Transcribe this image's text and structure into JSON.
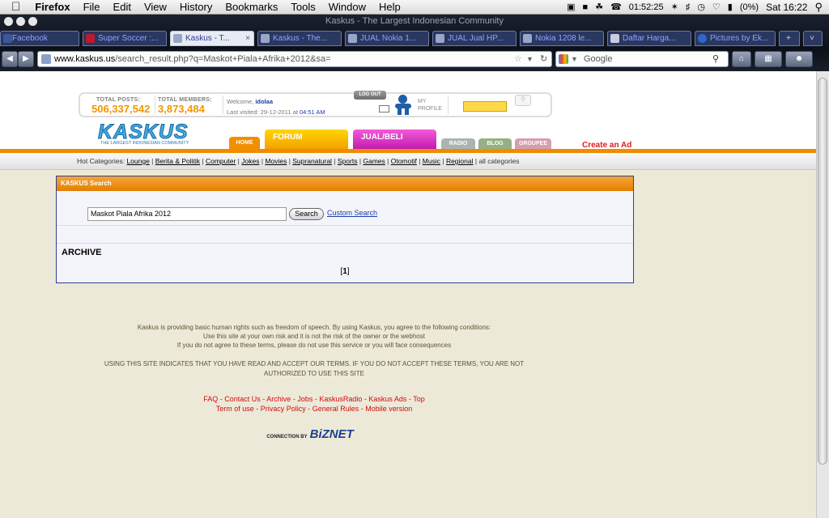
{
  "menubar": {
    "app": "Firefox",
    "items": [
      "File",
      "Edit",
      "View",
      "History",
      "Bookmarks",
      "Tools",
      "Window",
      "Help"
    ],
    "timer": "01:52:25",
    "battery": "(0%)",
    "clock": "Sat 16:22"
  },
  "window": {
    "title": "Kaskus - The Largest Indonesian Community"
  },
  "tabs": [
    {
      "label": "Facebook"
    },
    {
      "label": "Super Soccer :..."
    },
    {
      "label": "Kaskus - T..."
    },
    {
      "label": "Kaskus - The..."
    },
    {
      "label": "JUAL Nokia 1..."
    },
    {
      "label": "JUAL Jual HP..."
    },
    {
      "label": "Nokia 1208 le..."
    },
    {
      "label": "Daftar Harga..."
    },
    {
      "label": "Pictures by Ek..."
    }
  ],
  "navbar": {
    "url_domain": "www.kaskus.us",
    "url_path": "/search_result.php?q=Maskot+Piala+Afrika+2012&sa=",
    "search_engine": "Google"
  },
  "header": {
    "total_posts_label": "TOTAL POSTS:",
    "total_posts": "506,337,542",
    "total_members_label": "TOTAL MEMBERS:",
    "total_members": "3,873,484",
    "welcome_prefix": "Welcome,",
    "username": "idolaa",
    "last_visited_prefix": "Last visited: 29-12-2011 at",
    "last_visited_time": "04:51 AM",
    "logout": "LOG OUT",
    "my": "MY",
    "profile": "PROFILE",
    "logo": "KASKUS",
    "logo_sub": "THE LARGEST INDONESIAN COMMUNITY",
    "nav": [
      "HOME",
      "FORUM",
      "JUAL/BELI",
      "RADIO",
      "BLOG",
      "GROUPEE"
    ],
    "create_ad": "Create an Ad"
  },
  "categories": {
    "prefix": "Hot Categories:",
    "items": [
      "Lounge",
      "Berita & Politik",
      "Computer",
      "Jokes",
      "Movies",
      "Supranatural",
      "Sports",
      "Games",
      "Otomotif",
      "Music",
      "Regional"
    ],
    "all": "all categories"
  },
  "search": {
    "title": "KASKUS Search",
    "query": "Maskot Piala Afrika 2012",
    "button": "Search",
    "custom": "Custom Search",
    "section": "ARCHIVE",
    "page": "1"
  },
  "footer": {
    "line1": "Kaskus is providing basic human rights such as freedom of speech. By using Kaskus, you agree to the following conditions:",
    "line2": "Use this site at your own risk and it is not the risk of the owner or the webhost",
    "line3": "If you do not agree to these terms, please do not use this service or you will face consequences",
    "line4": "USING THIS SITE INDICATES THAT YOU HAVE READ AND ACCEPT OUR TERMS. IF YOU DO NOT ACCEPT THESE TERMS, YOU ARE NOT",
    "line5": "AUTHORIZED TO USE THIS SITE",
    "links1": [
      "FAQ",
      "Contact Us",
      "Archive",
      "Jobs",
      "KaskusRadio",
      "Kaskus Ads",
      "Top"
    ],
    "links2": [
      "Term of use",
      "Privacy Policy",
      "General Rules",
      "Mobile version"
    ],
    "connection": "CONNECTION BY",
    "biznet": "BiZNET"
  },
  "colors": {
    "accent": "#f08c00",
    "link": "#1a3ea8",
    "footer_link": "#d10b0b",
    "panel_border": "#2f3e96"
  }
}
